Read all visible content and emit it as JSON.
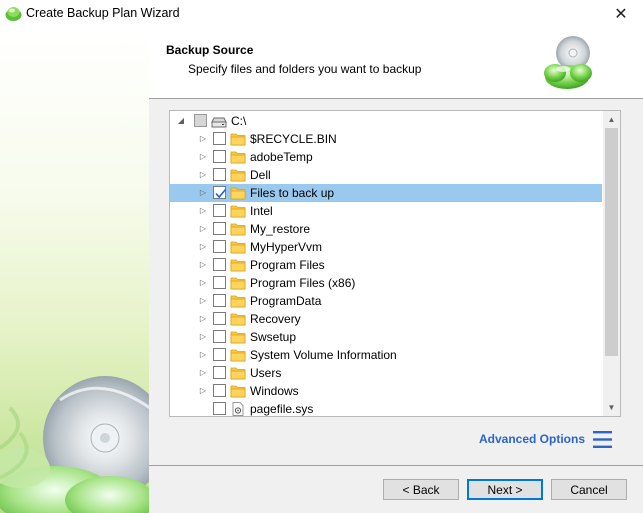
{
  "window": {
    "title": "Create Backup Plan Wizard",
    "close_glyph": "✕"
  },
  "header": {
    "title": "Backup Source",
    "subtitle": "Specify files and folders you want to backup"
  },
  "tree": {
    "root": {
      "label": "C:\\",
      "expanded": true,
      "checked": false,
      "partial": true,
      "icon": "drive-icon"
    },
    "items": [
      {
        "label": "$RECYCLE.BIN",
        "checked": false,
        "selected": false,
        "type": "folder"
      },
      {
        "label": "adobeTemp",
        "checked": false,
        "selected": false,
        "type": "folder"
      },
      {
        "label": "Dell",
        "checked": false,
        "selected": false,
        "type": "folder"
      },
      {
        "label": "Files to back up",
        "checked": true,
        "selected": true,
        "type": "folder"
      },
      {
        "label": "Intel",
        "checked": false,
        "selected": false,
        "type": "folder"
      },
      {
        "label": "My_restore",
        "checked": false,
        "selected": false,
        "type": "folder"
      },
      {
        "label": "MyHyperVvm",
        "checked": false,
        "selected": false,
        "type": "folder"
      },
      {
        "label": "Program Files",
        "checked": false,
        "selected": false,
        "type": "folder"
      },
      {
        "label": "Program Files (x86)",
        "checked": false,
        "selected": false,
        "type": "folder"
      },
      {
        "label": "ProgramData",
        "checked": false,
        "selected": false,
        "type": "folder"
      },
      {
        "label": "Recovery",
        "checked": false,
        "selected": false,
        "type": "folder"
      },
      {
        "label": "Swsetup",
        "checked": false,
        "selected": false,
        "type": "folder"
      },
      {
        "label": "System Volume Information",
        "checked": false,
        "selected": false,
        "type": "folder"
      },
      {
        "label": "Users",
        "checked": false,
        "selected": false,
        "type": "folder"
      },
      {
        "label": "Windows",
        "checked": false,
        "selected": false,
        "type": "folder"
      },
      {
        "label": "pagefile.sys",
        "checked": false,
        "selected": false,
        "type": "file"
      }
    ]
  },
  "advanced_options": {
    "label": "Advanced Options"
  },
  "buttons": {
    "back": "< Back",
    "next": "Next >",
    "cancel": "Cancel"
  },
  "colors": {
    "selection": "#99c9ef",
    "folder": "#ffc83d",
    "link": "#2d64c8",
    "check": "#1e64c8"
  }
}
